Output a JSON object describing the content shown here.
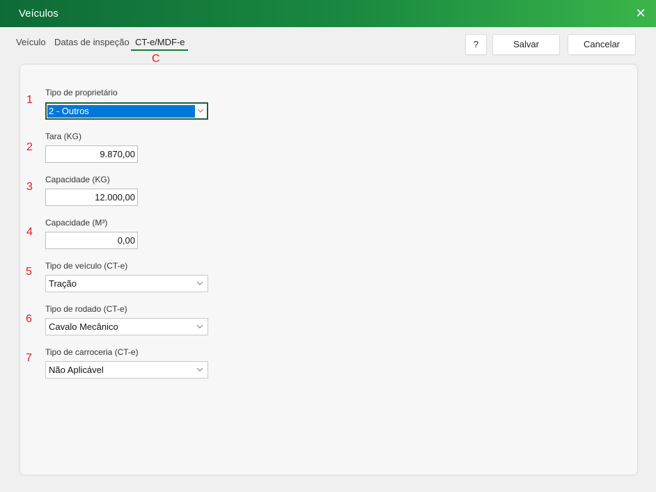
{
  "window": {
    "title": "Veículos",
    "close_glyph": "✕"
  },
  "tabs": [
    {
      "label": "Veículo"
    },
    {
      "label": "Datas de inspeção"
    },
    {
      "label": "CT-e/MDF-e",
      "active": true
    }
  ],
  "toolbar": {
    "help_label": "?",
    "save_label": "Salvar",
    "cancel_label": "Cancelar"
  },
  "annotations": {
    "tab_marker": "C",
    "markers": [
      "1",
      "2",
      "3",
      "4",
      "5",
      "6",
      "7"
    ]
  },
  "form": {
    "owner_type": {
      "label": "Tipo de proprietário",
      "value": "2 - Outros"
    },
    "tare": {
      "label": "Tara (KG)",
      "value": "9.870,00"
    },
    "capacity_kg": {
      "label": "Capacidade (KG)",
      "value": "12.000,00"
    },
    "capacity_m3": {
      "label": "Capacidade (M³)",
      "value": "0,00"
    },
    "vehicle_type": {
      "label": "Tipo de veículo (CT-e)",
      "value": "Tração"
    },
    "wheelset_type": {
      "label": "Tipo de rodado (CT-e)",
      "value": "Cavalo Mecânico"
    },
    "body_type": {
      "label": "Tipo de carroceria (CT-e)",
      "value": "Não Aplicável"
    }
  },
  "colors": {
    "accent": "#1a7a3c",
    "annotation": "#e0182a",
    "selection": "#0078d7"
  }
}
